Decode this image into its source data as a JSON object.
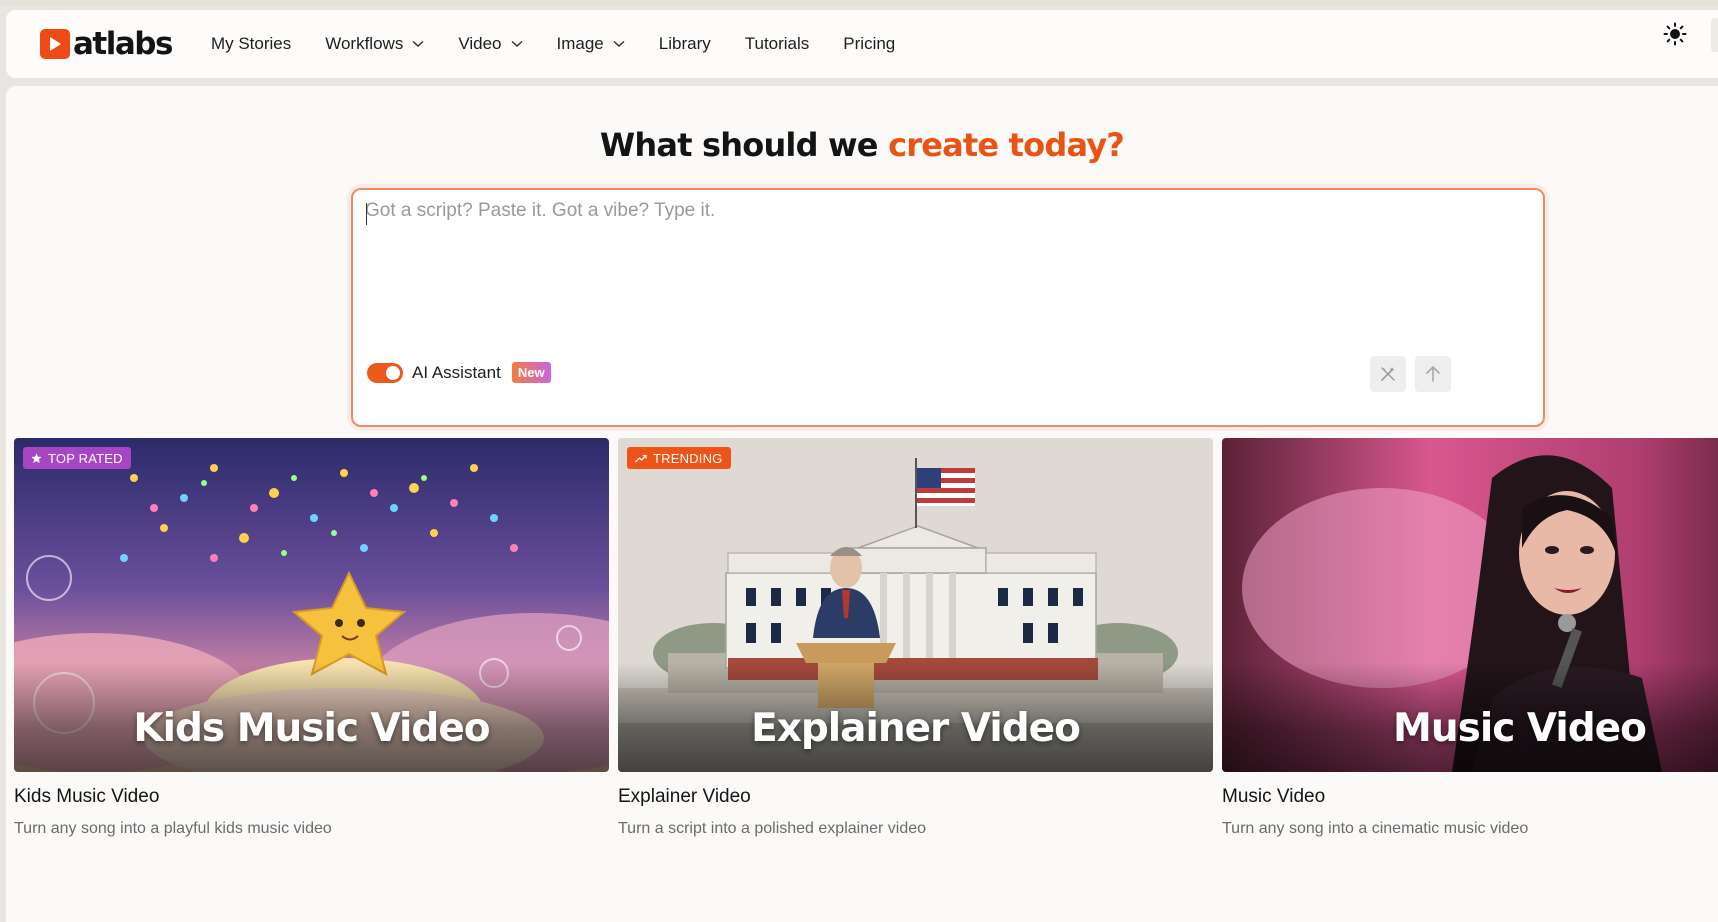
{
  "brand": {
    "name": "atlabs",
    "accent": "#ef4a18"
  },
  "nav": {
    "items": [
      {
        "label": "My Stories",
        "has_dropdown": false
      },
      {
        "label": "Workflows",
        "has_dropdown": true
      },
      {
        "label": "Video",
        "has_dropdown": true
      },
      {
        "label": "Image",
        "has_dropdown": true
      },
      {
        "label": "Library",
        "has_dropdown": false
      },
      {
        "label": "Tutorials",
        "has_dropdown": false
      },
      {
        "label": "Pricing",
        "has_dropdown": false
      }
    ],
    "theme_icon": "sun-icon"
  },
  "hero": {
    "title_main": "What should we",
    "title_accent": "create today?",
    "accent_color": "#e95414"
  },
  "prompt": {
    "placeholder": "Got a script? Paste it. Got a vibe? Type it.",
    "value": "",
    "ai_assistant_label": "AI Assistant",
    "ai_assistant_enabled": true,
    "new_badge": "New",
    "magic_icon": "magic-wand-icon",
    "send_icon": "arrow-up-icon"
  },
  "cards": [
    {
      "badge": "TOP RATED",
      "badge_icon": "star-icon",
      "badge_color": "#a646c2",
      "overlay_title": "Kids Music Video",
      "title": "Kids Music Video",
      "description": "Turn any song into a playful kids music video"
    },
    {
      "badge": "TRENDING",
      "badge_icon": "trending-up-icon",
      "badge_color": "#ee5418",
      "overlay_title": "Explainer Video",
      "title": "Explainer Video",
      "description": "Turn a script into a polished explainer video"
    },
    {
      "badge": "",
      "overlay_title": "Music Video",
      "title": "Music Video",
      "description": "Turn any song into a cinematic music video"
    }
  ]
}
